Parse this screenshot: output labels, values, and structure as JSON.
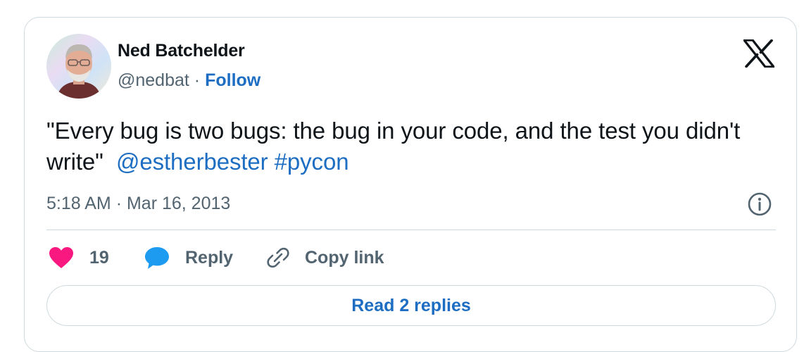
{
  "author": {
    "name": "Ned Batchelder",
    "handle": "@nedbat",
    "separator": "·",
    "follow_label": "Follow"
  },
  "tweet": {
    "text_before": "\"Every bug is two bugs: the bug in your code, and the test you didn't write\"",
    "mention": "@estherbester",
    "hashtag": "#pycon",
    "time": "5:18 AM",
    "date_separator": "·",
    "date": "Mar 16, 2013"
  },
  "actions": {
    "like_count": "19",
    "reply_label": "Reply",
    "copy_link_label": "Copy link"
  },
  "read_replies_label": "Read 2 replies",
  "icons": {
    "brand": "x-logo-icon",
    "info": "info-icon",
    "like": "heart-icon",
    "reply": "speech-bubble-icon",
    "copy": "link-icon"
  },
  "colors": {
    "accent": "#1d6ec2",
    "like": "#f91880",
    "reply": "#1d9bf0",
    "text": "#0f1419",
    "secondary": "#536471",
    "border": "#cfd9de"
  }
}
